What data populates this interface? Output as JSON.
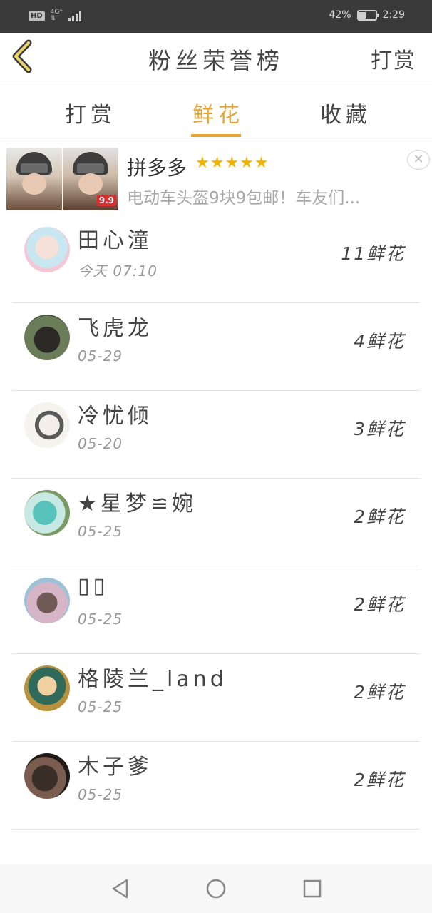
{
  "status_bar": {
    "hd": "HD",
    "network_top": "4G⁺",
    "network_bottom": "⇅",
    "battery_percent_text": "42%",
    "battery_level": 0.42,
    "time": "2:29"
  },
  "nav": {
    "back_icon": "chevron-left-icon",
    "title": "粉丝荣誉榜",
    "action": "打赏",
    "accent_color": "#e3a434"
  },
  "tabs": [
    {
      "label": "打赏",
      "active": false
    },
    {
      "label": "鲜花",
      "active": true
    },
    {
      "label": "收藏",
      "active": false
    }
  ],
  "ad": {
    "title": "拼多多",
    "stars": "★★★★★",
    "description": "电动车头盔9块9包邮！车友们...",
    "price_tag": "9.9",
    "close_icon": "close-icon"
  },
  "fans": [
    {
      "name": "田心潼",
      "date": "今天 07:10",
      "count": "11鲜花"
    },
    {
      "name": "飞虎龙",
      "date": "05-29",
      "count": "4鲜花"
    },
    {
      "name": "冷忧倾",
      "date": "05-20",
      "count": "3鲜花"
    },
    {
      "name": "★星梦≌婉",
      "date": "05-25",
      "count": "2鲜花"
    },
    {
      "name": "▯▯",
      "date": "05-25",
      "count": "2鲜花"
    },
    {
      "name": "格陵兰_land",
      "date": "05-25",
      "count": "2鲜花"
    },
    {
      "name": "木子爹",
      "date": "05-25",
      "count": "2鲜花"
    }
  ],
  "system_nav": {
    "back": "triangle-back-icon",
    "home": "circle-home-icon",
    "recents": "square-recents-icon"
  }
}
